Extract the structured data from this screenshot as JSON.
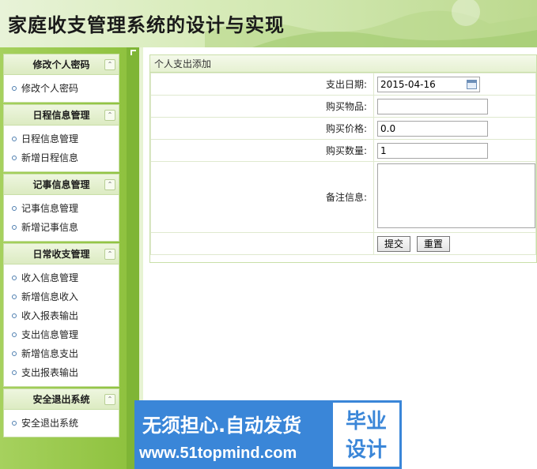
{
  "banner": {
    "title": "家庭收支管理系统的设计与实现"
  },
  "sidebar": {
    "groups": [
      {
        "header": "修改个人密码",
        "items": [
          "修改个人密码"
        ]
      },
      {
        "header": "日程信息管理",
        "items": [
          "日程信息管理",
          "新增日程信息"
        ]
      },
      {
        "header": "记事信息管理",
        "items": [
          "记事信息管理",
          "新增记事信息"
        ]
      },
      {
        "header": "日常收支管理",
        "items": [
          "收入信息管理",
          "新增信息收入",
          "收入报表输出",
          "支出信息管理",
          "新增信息支出",
          "支出报表输出"
        ]
      },
      {
        "header": "安全退出系统",
        "items": [
          "安全退出系统"
        ]
      }
    ]
  },
  "form": {
    "title": "个人支出添加",
    "date_label": "支出日期:",
    "date_value": "2015-04-16",
    "item_label": "购买物品:",
    "item_value": "",
    "price_label": "购买价格:",
    "price_value": "0.0",
    "qty_label": "购买数量:",
    "qty_value": "1",
    "notes_label": "备注信息:",
    "notes_value": "",
    "submit_label": "提交",
    "reset_label": "重置"
  },
  "watermark": {
    "line1": "无须担心.自动发货",
    "line2": "www.51topmind.com",
    "badge": "毕业设计"
  },
  "colors": {
    "sidebar_green": "#8fc23f",
    "accent_blue": "#3a86d8"
  }
}
